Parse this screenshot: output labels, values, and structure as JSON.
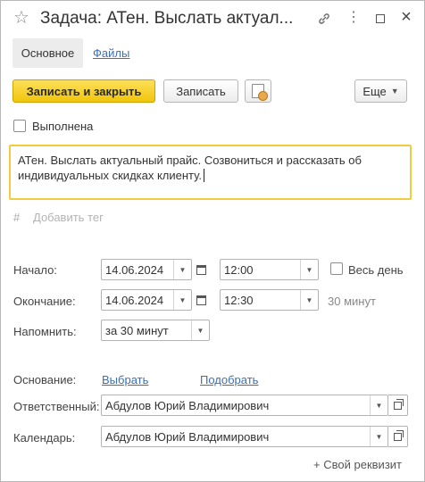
{
  "window": {
    "title": "Задача: АТен. Выслать актуал..."
  },
  "titlebar_icons": [
    "star-icon",
    "link-icon",
    "more-vertical-icon",
    "maximize-icon",
    "close-icon"
  ],
  "tabs": {
    "main": "Основное",
    "files": "Файлы"
  },
  "toolbar": {
    "save_close": "Записать и закрыть",
    "save": "Записать",
    "more": "Еще"
  },
  "form": {
    "done_label": "Выполнена",
    "description": "АТен. Выслать актуальный прайс. Созвониться и рассказать об индивидуальных скидках клиенту.",
    "tag_hash": "#",
    "add_tag": "Добавить тег",
    "start_label": "Начало:",
    "start_date": "14.06.2024",
    "start_time": "12:00",
    "all_day_label": "Весь день",
    "end_label": "Окончание:",
    "end_date": "14.06.2024",
    "end_time": "12:30",
    "duration": "30 минут",
    "remind_label": "Напомнить:",
    "remind_value": "за 30 минут",
    "basis_label": "Основание:",
    "basis_select": "Выбрать",
    "basis_pick": "Подобрать",
    "responsible_label": "Ответственный:",
    "responsible_value": "Абдулов Юрий Владимирович",
    "calendar_label": "Календарь:",
    "calendar_value": "Абдулов Юрий Владимирович",
    "own_requisite": "+ Свой реквизит"
  },
  "colors": {
    "primary_button": "#f1c50b",
    "focus_border": "#f1cc3d",
    "link": "#3d6fb4"
  }
}
